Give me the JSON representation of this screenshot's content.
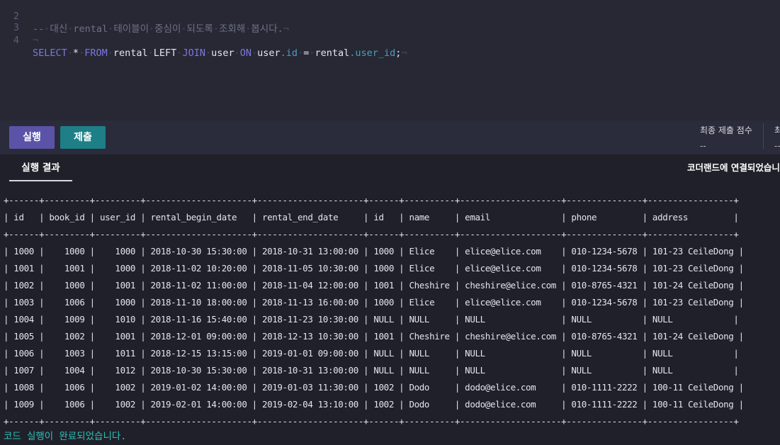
{
  "editor": {
    "lines": [
      {
        "no": "2",
        "segments": [
          {
            "text": "--",
            "cls": "cm"
          },
          {
            "text": "·",
            "cls": "ws"
          },
          {
            "text": "대신",
            "cls": "cm"
          },
          {
            "text": "·",
            "cls": "ws"
          },
          {
            "text": "rental",
            "cls": "cm"
          },
          {
            "text": "·",
            "cls": "ws"
          },
          {
            "text": "테이블이",
            "cls": "cm"
          },
          {
            "text": "·",
            "cls": "ws"
          },
          {
            "text": "중심이",
            "cls": "cm"
          },
          {
            "text": "·",
            "cls": "ws"
          },
          {
            "text": "되도록",
            "cls": "cm"
          },
          {
            "text": "·",
            "cls": "ws"
          },
          {
            "text": "조회해",
            "cls": "cm"
          },
          {
            "text": "·",
            "cls": "ws"
          },
          {
            "text": "봅시다.",
            "cls": "cm"
          },
          {
            "text": "¬",
            "cls": "ws"
          }
        ]
      },
      {
        "no": "3",
        "segments": [
          {
            "text": "¬",
            "cls": "ws"
          }
        ]
      },
      {
        "no": "4",
        "segments": [
          {
            "text": "SELECT",
            "cls": "kw"
          },
          {
            "text": "·",
            "cls": "ws"
          },
          {
            "text": "*",
            "cls": ""
          },
          {
            "text": "·",
            "cls": "ws"
          },
          {
            "text": "FROM",
            "cls": "kw"
          },
          {
            "text": "·",
            "cls": "ws"
          },
          {
            "text": "rental",
            "cls": ""
          },
          {
            "text": "·",
            "cls": "ws"
          },
          {
            "text": "LEFT",
            "cls": ""
          },
          {
            "text": "·",
            "cls": "ws"
          },
          {
            "text": "JOIN",
            "cls": "kw"
          },
          {
            "text": "·",
            "cls": "ws"
          },
          {
            "text": "user",
            "cls": ""
          },
          {
            "text": "·",
            "cls": "ws"
          },
          {
            "text": "ON",
            "cls": "kw"
          },
          {
            "text": "·",
            "cls": "ws"
          },
          {
            "text": "user",
            "cls": ""
          },
          {
            "text": ".id",
            "cls": "fld"
          },
          {
            "text": "·",
            "cls": "ws"
          },
          {
            "text": "=",
            "cls": ""
          },
          {
            "text": "·",
            "cls": "ws"
          },
          {
            "text": "rental",
            "cls": ""
          },
          {
            "text": ".user_id",
            "cls": "fld"
          },
          {
            "text": ";",
            "cls": ""
          },
          {
            "text": "¬",
            "cls": "ws"
          }
        ]
      }
    ]
  },
  "toolbar": {
    "run_label": "실행",
    "submit_label": "제출",
    "final_score_label": "최종 제출 점수",
    "final_score_value": "--",
    "second_score_label": "최",
    "second_score_value": "--"
  },
  "tabs": {
    "result_label": "실행 결과",
    "connection_status": "코더랜드에 연결되었습니다"
  },
  "console": {
    "lines": [
      "+------+---------+---------+---------------------+---------------------+------+----------+--------------------+---------------+-----------------+",
      "| id   | book_id | user_id | rental_begin_date   | rental_end_date     | id   | name     | email              | phone         | address         |",
      "+------+---------+---------+---------------------+---------------------+------+----------+--------------------+---------------+-----------------+",
      "| 1000 |    1000 |    1000 | 2018-10-30 15:30:00 | 2018-10-31 13:00:00 | 1000 | Elice    | elice@elice.com    | 010-1234-5678 | 101-23 CeileDong |",
      "| 1001 |    1001 |    1000 | 2018-11-02 10:20:00 | 2018-11-05 10:30:00 | 1000 | Elice    | elice@elice.com    | 010-1234-5678 | 101-23 CeileDong |",
      "| 1002 |    1000 |    1001 | 2018-11-02 11:00:00 | 2018-11-04 12:00:00 | 1001 | Cheshire | cheshire@elice.com | 010-8765-4321 | 101-24 CeileDong |",
      "| 1003 |    1006 |    1000 | 2018-11-10 18:00:00 | 2018-11-13 16:00:00 | 1000 | Elice    | elice@elice.com    | 010-1234-5678 | 101-23 CeileDong |",
      "| 1004 |    1009 |    1010 | 2018-11-16 15:40:00 | 2018-11-23 10:30:00 | NULL | NULL     | NULL               | NULL          | NULL            |",
      "| 1005 |    1002 |    1001 | 2018-12-01 09:00:00 | 2018-12-13 10:30:00 | 1001 | Cheshire | cheshire@elice.com | 010-8765-4321 | 101-24 CeileDong |",
      "| 1006 |    1003 |    1011 | 2018-12-15 13:15:00 | 2019-01-01 09:00:00 | NULL | NULL     | NULL               | NULL          | NULL            |",
      "| 1007 |    1004 |    1012 | 2018-10-30 15:30:00 | 2018-10-31 13:00:00 | NULL | NULL     | NULL               | NULL          | NULL            |",
      "| 1008 |    1006 |    1002 | 2019-01-02 14:00:00 | 2019-01-03 11:30:00 | 1002 | Dodo     | dodo@elice.com     | 010-1111-2222 | 100-11 CeileDong |",
      "| 1009 |    1006 |    1002 | 2019-02-01 14:00:00 | 2019-02-04 13:10:00 | 1002 | Dodo     | dodo@elice.com     | 010-1111-2222 | 100-11 CeileDong |",
      "+------+---------+---------+---------------------+---------------------+------+----------+--------------------+---------------+-----------------+"
    ],
    "status": "코드 실행이 완료되었습니다."
  },
  "colors": {
    "run_button": "#5a53a8",
    "submit_button": "#1e7f86",
    "keyword": "#7b78e0",
    "success_text": "#2fc0b8"
  }
}
